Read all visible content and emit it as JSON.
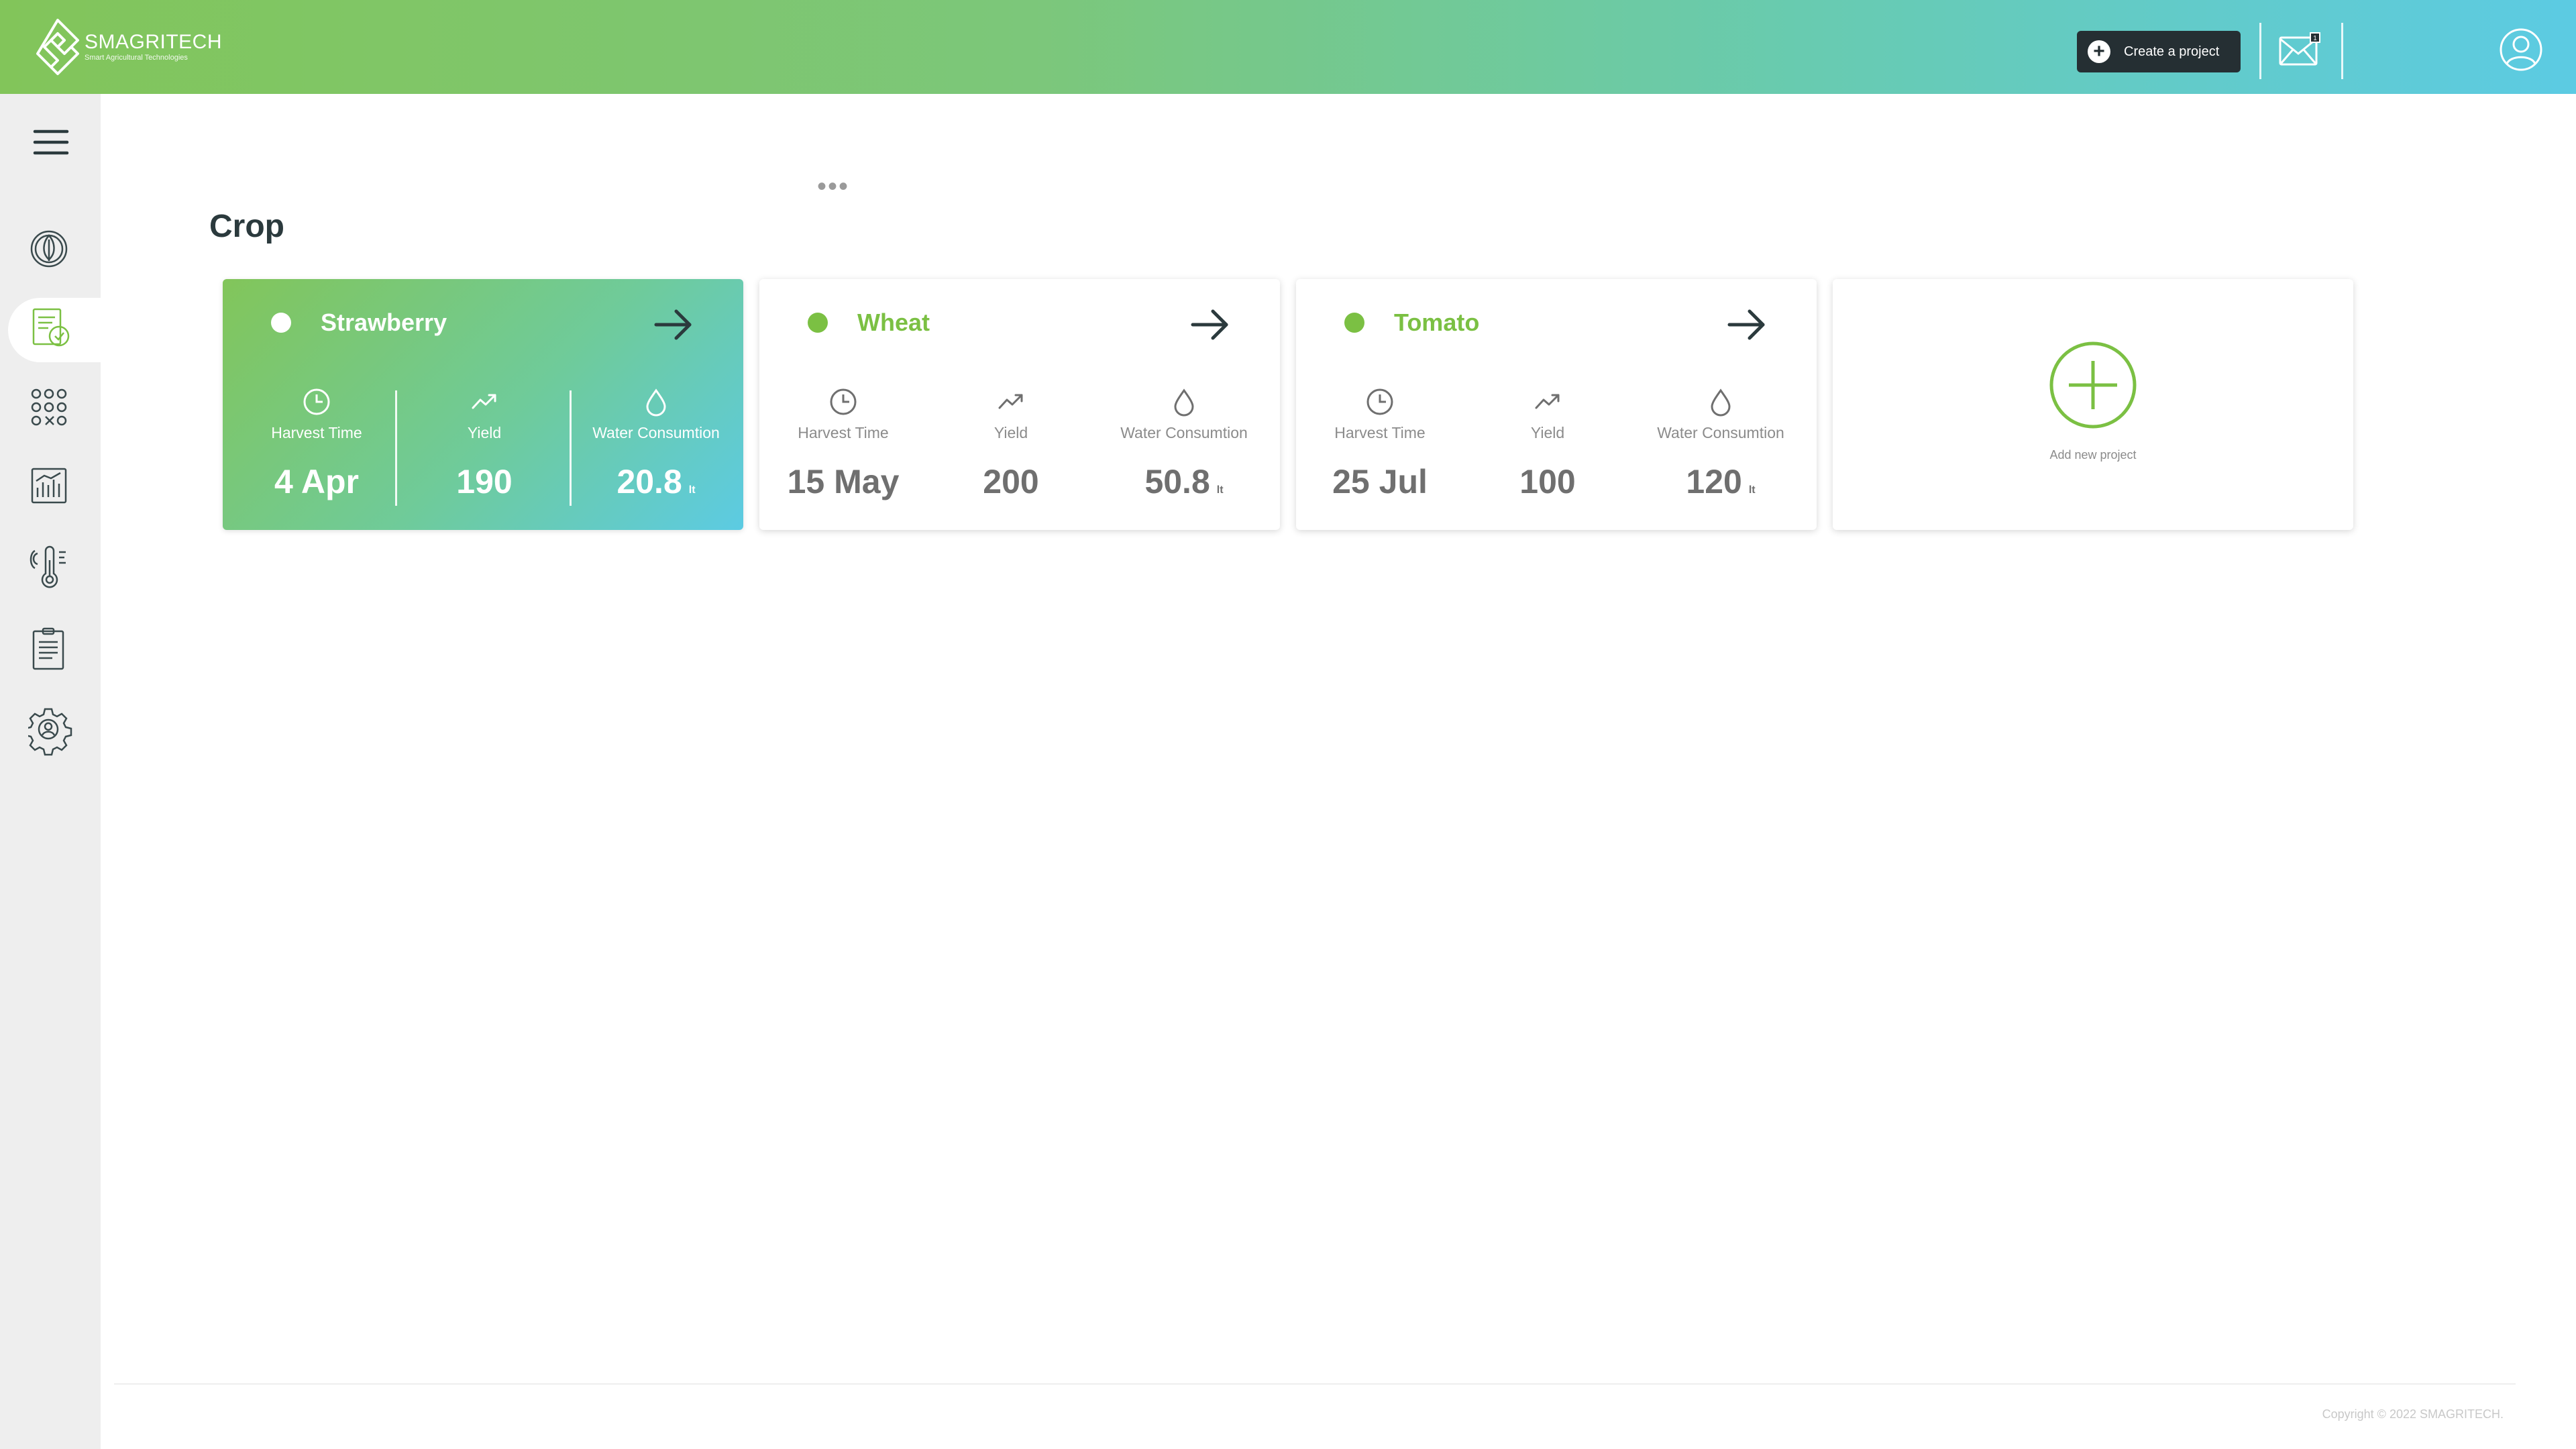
{
  "brand": {
    "name": "SMAGRITECH",
    "tagline": "Smart Agricultural Technologies"
  },
  "header": {
    "create_project_label": "Create a project",
    "mail_badge": "1"
  },
  "sidebar": {
    "items": [
      {
        "icon": "leaf-globe-icon",
        "active": false
      },
      {
        "icon": "crop-report-icon",
        "active": true
      },
      {
        "icon": "apps-grid-icon",
        "active": false
      },
      {
        "icon": "analytics-chart-icon",
        "active": false
      },
      {
        "icon": "weather-thermometer-icon",
        "active": false
      },
      {
        "icon": "clipboard-icon",
        "active": false
      },
      {
        "icon": "settings-gear-icon",
        "active": false
      }
    ]
  },
  "main": {
    "overflow_dots": "•••",
    "title": "Crop",
    "cards": [
      {
        "name": "Strawberry",
        "active": true,
        "harvest_label": "Harvest Time",
        "harvest_value": "4 Apr",
        "yield_label": "Yield",
        "yield_value": "190",
        "water_label": "Water Consumtion",
        "water_value": "20.8",
        "water_unit": "lt"
      },
      {
        "name": "Wheat",
        "active": false,
        "harvest_label": "Harvest Time",
        "harvest_value": "15 May",
        "yield_label": "Yield",
        "yield_value": "200",
        "water_label": "Water Consumtion",
        "water_value": "50.8",
        "water_unit": "lt"
      },
      {
        "name": "Tomato",
        "active": false,
        "harvest_label": "Harvest Time",
        "harvest_value": "25 Jul",
        "yield_label": "Yield",
        "yield_value": "100",
        "water_label": "Water Consumtion",
        "water_value": "120",
        "water_unit": "lt"
      }
    ],
    "add_new_label": "Add new project"
  },
  "footer": {
    "copyright": "Copyright © 2022 SMAGRITECH."
  },
  "colors": {
    "accent_green": "#7bc043",
    "dark_button": "#252f33",
    "gradient_start": "#82c55a",
    "gradient_end": "#5ccbe3"
  }
}
